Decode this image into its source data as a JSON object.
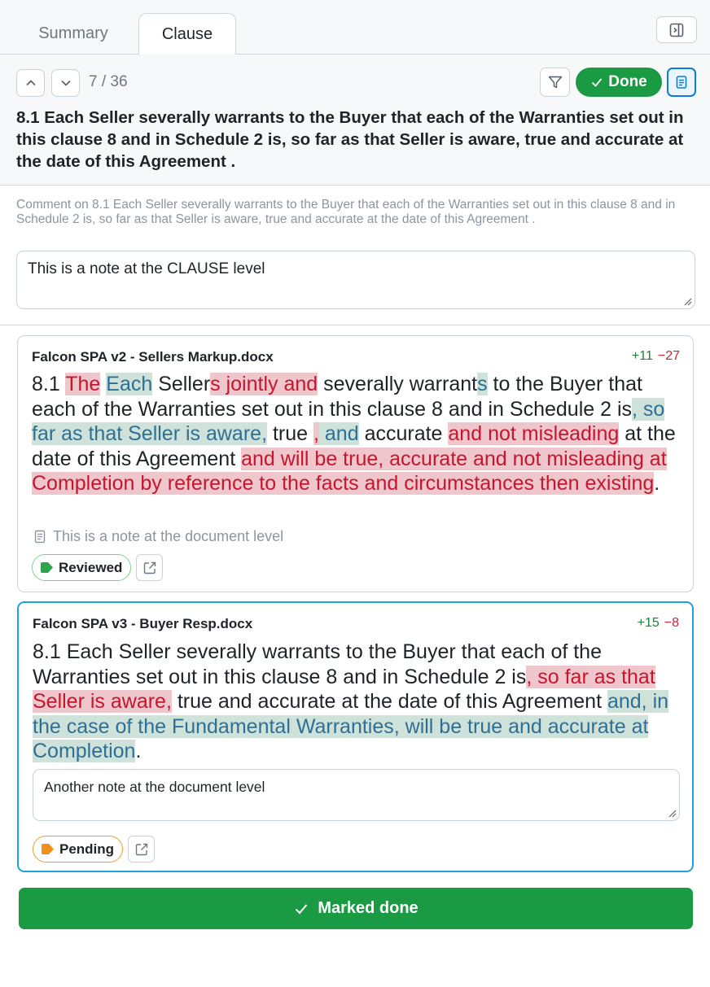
{
  "tabs": [
    {
      "label": "Summary",
      "active": false
    },
    {
      "label": "Clause",
      "active": true
    }
  ],
  "nav": {
    "counter": "7 / 36"
  },
  "status_button": {
    "label": "Done",
    "color": "#1a9a43"
  },
  "clause": {
    "title": "8.1 Each Seller severally warrants to the Buyer that each of the Warranties set out in this clause 8 and in Schedule 2 is, so far as that Seller is aware, true and accurate at the date of this Agreement ."
  },
  "comment": {
    "label": "Comment on 8.1 Each Seller severally warrants to the Buyer that each of the Warranties set out in this clause 8 and in Schedule 2 is, so far as that Seller is aware, true and accurate at the date of this Agreement .",
    "value": "This is a note at the CLAUSE level"
  },
  "documents": [
    {
      "filename": "Falcon SPA v2 - Sellers Markup.docx",
      "added": "+11",
      "removed": "−27",
      "segments": [
        {
          "t": "8.1   ",
          "k": "n"
        },
        {
          "t": "The",
          "k": "del"
        },
        {
          "t": " ",
          "k": "n"
        },
        {
          "t": "Each",
          "k": "ins"
        },
        {
          "t": " Seller",
          "k": "n"
        },
        {
          "t": "s jointly and",
          "k": "del"
        },
        {
          "t": " severally warrant",
          "k": "n"
        },
        {
          "t": "s",
          "k": "ins"
        },
        {
          "t": " to the Buyer that each of the Warranties set out in this clause 8 and in Schedule 2 is",
          "k": "n"
        },
        {
          "t": ", so far as that Seller is aware,",
          "k": "ins"
        },
        {
          "t": " true ",
          "k": "n"
        },
        {
          "t": ",",
          "k": "del"
        },
        {
          "t": " and",
          "k": "ins"
        },
        {
          "t": " accurate ",
          "k": "n"
        },
        {
          "t": "and not misleading",
          "k": "del"
        },
        {
          "t": " at the date of this Agreement ",
          "k": "n"
        },
        {
          "t": "and will be true, accurate and not misleading at Completion by reference to the facts and circumstances then existing",
          "k": "del"
        },
        {
          "t": ".",
          "k": "n"
        }
      ],
      "note": "This is a note at the document level",
      "status": "Reviewed",
      "status_color": "#2da44e"
    },
    {
      "filename": "Falcon SPA v3 - Buyer Resp.docx",
      "added": "+15",
      "removed": "−8",
      "segments": [
        {
          "t": "8.1   Each Seller severally warrants to the Buyer that each of the Warranties set out in this clause 8 and in Schedule 2 is",
          "k": "n"
        },
        {
          "t": ", so far as that Seller is aware,",
          "k": "del"
        },
        {
          "t": " true and accurate at the date of this Agreement ",
          "k": "n"
        },
        {
          "t": "and, in the case of the Fundamental Warranties, will be true and accurate at Completion",
          "k": "ins"
        },
        {
          "t": ".",
          "k": "n"
        }
      ],
      "note": "Another note at the document level",
      "status": "Pending",
      "status_color": "#f0901c"
    }
  ],
  "footer": {
    "marked_done_label": "Marked done"
  }
}
